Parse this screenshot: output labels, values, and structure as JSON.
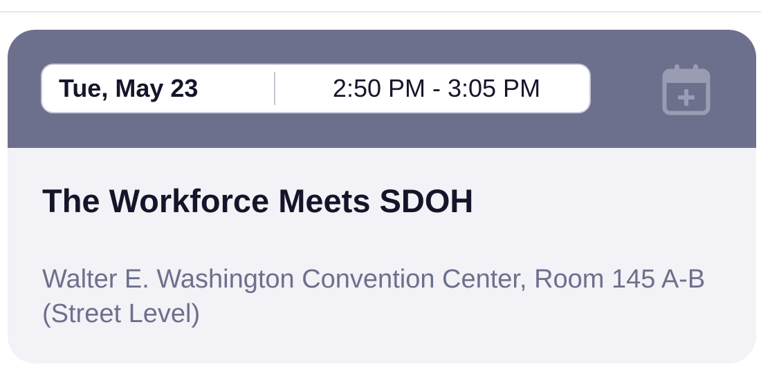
{
  "session": {
    "date": "Tue, May 23",
    "time_range": "2:50 PM - 3:05 PM",
    "title": "The Workforce Meets SDOH",
    "location": "Walter E. Washington Convention Center, Room 145 A-B (Street Level)",
    "add_to_calendar_icon": "calendar-plus-icon"
  },
  "colors": {
    "header_bg": "#6d708c",
    "card_bg": "#f2f2f7",
    "title_text": "#15152a",
    "location_text": "#6d708c",
    "icon": "#9a9cb3"
  }
}
